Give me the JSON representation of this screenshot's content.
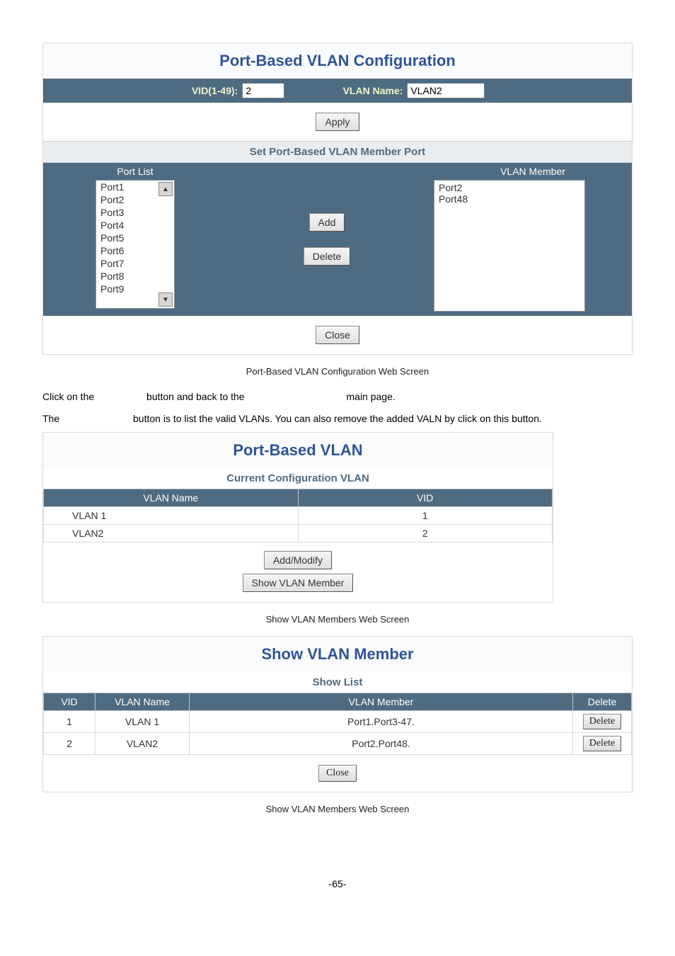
{
  "panel1": {
    "title": "Port-Based  VLAN Configuration",
    "vid_label": "VID(1-49):",
    "vid_value": "2",
    "vlan_name_label": "VLAN Name:",
    "vlan_name_value": "VLAN2",
    "apply_btn": "Apply",
    "section_sub": "Set Port-Based VLAN Member Port",
    "port_list_head": "Port List",
    "vlan_member_head": "VLAN Member",
    "port_list": [
      "Port1",
      "Port2",
      "Port3",
      "Port4",
      "Port5",
      "Port6",
      "Port7",
      "Port8",
      "Port9"
    ],
    "vlan_members": [
      "Port2",
      "Port48"
    ],
    "add_btn": "Add",
    "delete_btn": "Delete",
    "close_btn": "Close"
  },
  "caption1": "Port-Based VLAN Configuration Web Screen",
  "text1_a": "Click on the",
  "text1_b": "button and back to the",
  "text1_c": "main page.",
  "text2_a": "The",
  "text2_b": "button is to list the valid VLANs. You can also remove the added VALN by click on this button.",
  "panel2": {
    "title": "Port-Based  VLAN",
    "subtitle": "Current Configuration VLAN",
    "col_name": "VLAN Name",
    "col_vid": "VID",
    "rows": [
      {
        "name": "VLAN 1",
        "vid": "1"
      },
      {
        "name": "VLAN2",
        "vid": "2"
      }
    ],
    "add_modify_btn": "Add/Modify",
    "show_member_btn": "Show VLAN Member"
  },
  "caption2": "Show VLAN Members Web Screen",
  "panel3": {
    "title": "Show VLAN Member",
    "subtitle": "Show List",
    "col_vid": "VID",
    "col_name": "VLAN Name",
    "col_member": "VLAN Member",
    "col_delete": "Delete",
    "rows": [
      {
        "vid": "1",
        "name": "VLAN 1",
        "member": "Port1.Port3-47."
      },
      {
        "vid": "2",
        "name": "VLAN2",
        "member": "Port2.Port48."
      }
    ],
    "delete_btn": "Delete",
    "close_btn": "Close"
  },
  "caption3": "Show VLAN Members Web Screen",
  "page_num": "-65-"
}
